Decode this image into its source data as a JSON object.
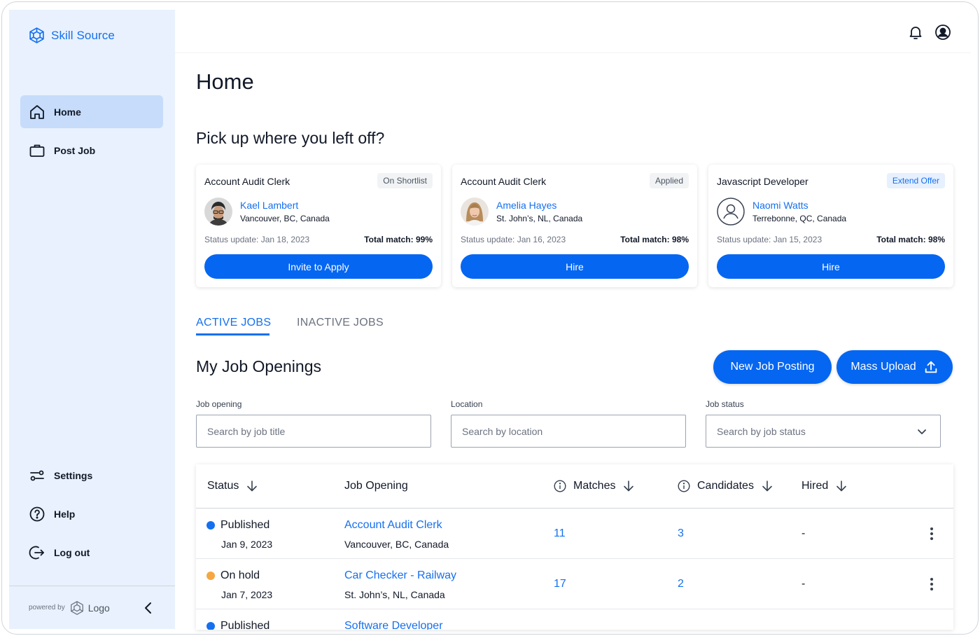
{
  "brand": {
    "name": "Skill Source",
    "accent": "#1570ef"
  },
  "sidebar": {
    "items": [
      {
        "label": "Home",
        "icon": "home-icon",
        "active": true
      },
      {
        "label": "Post Job",
        "icon": "briefcase-icon",
        "active": false
      }
    ],
    "bottom_items": [
      {
        "label": "Settings",
        "icon": "settings-sliders-icon"
      },
      {
        "label": "Help",
        "icon": "help-icon"
      },
      {
        "label": "Log out",
        "icon": "logout-icon"
      }
    ],
    "footer": {
      "powered_by": "powered by",
      "logo_text": "Logo"
    }
  },
  "page": {
    "title": "Home",
    "section_title": "Pick up where you left off?"
  },
  "cards": [
    {
      "title": "Account Audit Clerk",
      "badge": "On Shortlist",
      "candidate_name": "Kael Lambert",
      "candidate_location": "Vancouver, BC, Canada",
      "status_label": "Status update:",
      "status_date": "Jan 18, 2023",
      "match": "Total match: 99%",
      "action": "Invite to Apply"
    },
    {
      "title": "Account Audit Clerk",
      "badge": "Applied",
      "candidate_name": "Amelia Hayes",
      "candidate_location": "St. John’s, NL, Canada",
      "status_label": "Status update:",
      "status_date": "Jan 16, 2023",
      "match": "Total match: 98%",
      "action": "Hire"
    },
    {
      "title": "Javascript Developer",
      "badge": "Extend Offer",
      "candidate_name": "Naomi Watts",
      "candidate_location": "Terrebonne, QC, Canada",
      "status_label": "Status update:",
      "status_date": "Jan 15, 2023",
      "match": "Total match: 98%",
      "action": "Hire"
    }
  ],
  "tabs": [
    {
      "label": "ACTIVE JOBS",
      "active": true
    },
    {
      "label": "INACTIVE JOBS",
      "active": false
    }
  ],
  "openings": {
    "title": "My Job Openings",
    "new_posting": "New Job Posting",
    "mass_upload": "Mass Upload"
  },
  "filters": {
    "job_opening": {
      "label": "Job opening",
      "placeholder": "Search by job title"
    },
    "location": {
      "label": "Location",
      "placeholder": "Search by location"
    },
    "job_status": {
      "label": "Job status",
      "placeholder": "Search by job status"
    }
  },
  "table": {
    "headers": {
      "status": "Status",
      "job_opening": "Job Opening",
      "matches": "Matches",
      "candidates": "Candidates",
      "hired": "Hired"
    },
    "rows": [
      {
        "status": "Published",
        "status_color": "#1570ef",
        "date": "Jan 9, 2023",
        "job": "Account Audit Clerk",
        "location": "Vancouver, BC, Canada",
        "matches": "11",
        "candidates": "3",
        "hired": "-"
      },
      {
        "status": "On hold",
        "status_color": "#f5a742",
        "date": "Jan 7, 2023",
        "job": "Car Checker - Railway",
        "location": "St. John’s, NL, Canada",
        "matches": "17",
        "candidates": "2",
        "hired": "-"
      },
      {
        "status": "Published",
        "status_color": "#1570ef",
        "date": "",
        "job": "Software Developer",
        "location": "",
        "matches": "",
        "candidates": "",
        "hired": ""
      }
    ]
  }
}
